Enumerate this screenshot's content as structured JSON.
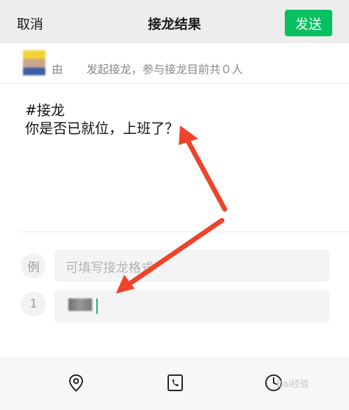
{
  "header": {
    "cancel_label": "取消",
    "title": "接龙结果",
    "send_label": "发送"
  },
  "initiator": {
    "by_label": "由",
    "started_text": "发起接龙，参与接龙目前共０人"
  },
  "content": {
    "line1": "#接龙",
    "line2": "你是否已就位，上班了？"
  },
  "example": {
    "label": "例",
    "placeholder": "可填写接龙格式"
  },
  "entry": {
    "number": "1"
  },
  "toolbar": {
    "icons": [
      "location-icon",
      "phone-icon",
      "clock-icon"
    ]
  },
  "colors": {
    "accent": "#07c160",
    "arrow": "#f0432b",
    "caret": "#1aad7a"
  },
  "watermark": {
    "text": "Bai经验"
  }
}
